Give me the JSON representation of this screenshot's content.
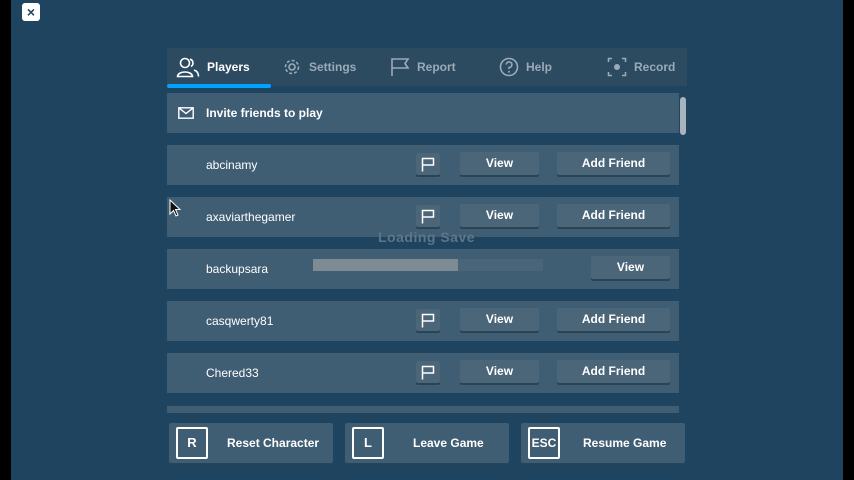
{
  "close_label": "×",
  "tabs": [
    {
      "label": "Players",
      "icon": "players-icon",
      "active": true
    },
    {
      "label": "Settings",
      "icon": "gear-icon",
      "active": false
    },
    {
      "label": "Report",
      "icon": "flag-icon",
      "active": false
    },
    {
      "label": "Help",
      "icon": "help-icon",
      "active": false
    },
    {
      "label": "Record",
      "icon": "record-icon",
      "active": false
    }
  ],
  "invite": {
    "label": "Invite friends to play",
    "icon": "mail-icon"
  },
  "players": [
    {
      "name": "abcinamy",
      "view": "View",
      "add_friend": "Add Friend"
    },
    {
      "name": "axaviarthegamer",
      "view": "View",
      "add_friend": "Add Friend"
    },
    {
      "name": "backupsara",
      "view": "View",
      "progress": 0.63
    },
    {
      "name": "casqwerty81",
      "view": "View",
      "add_friend": "Add Friend"
    },
    {
      "name": "Chered33",
      "view": "View",
      "add_friend": "Add Friend"
    }
  ],
  "overlay_text": "Loading Save",
  "bottom": {
    "reset": {
      "key": "R",
      "label": "Reset Character"
    },
    "leave": {
      "key": "L",
      "label": "Leave Game"
    },
    "resume": {
      "key": "ESC",
      "label": "Resume Game"
    }
  },
  "colors": {
    "background": "#1f4460",
    "row": "#3f5d73",
    "button": "#4b6579",
    "accent": "#00a2ff"
  }
}
